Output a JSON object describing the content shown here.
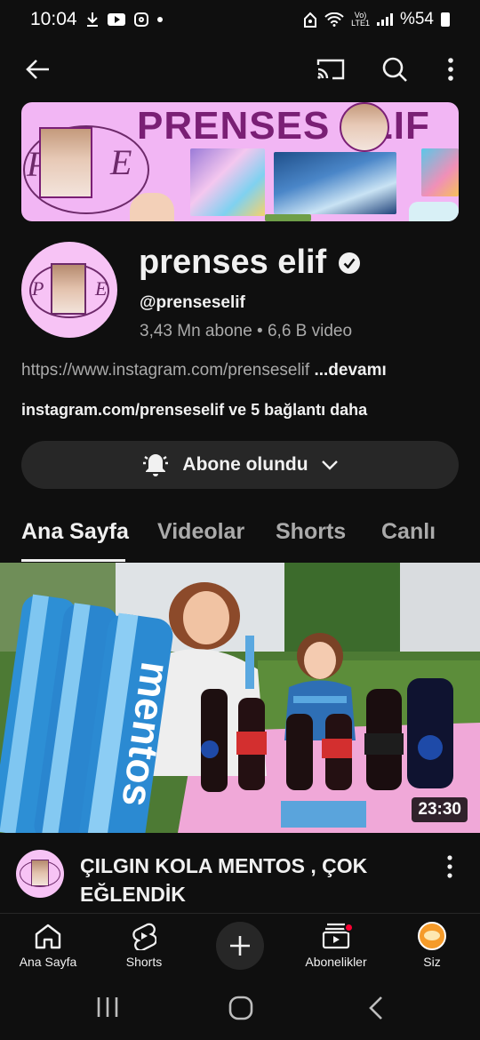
{
  "status_bar": {
    "time": "10:04",
    "battery": "%54",
    "network": "LTE1"
  },
  "banner": {
    "title": "PRENSES ELIF",
    "logo_letters": [
      "P",
      "E"
    ]
  },
  "channel": {
    "name": "prenses elif",
    "handle": "@prenseselif",
    "subscribers": "3,43 Mn abone",
    "separator": "•",
    "videos": "6,6 B video",
    "description": "https://www.instagram.com/prenseselif",
    "more_label": "...devamı",
    "links_text": "instagram.com/prenseselif ve 5 bağlantı daha",
    "subscribe_label": "Abone olundu"
  },
  "tabs": [
    {
      "label": "Ana Sayfa",
      "active": true
    },
    {
      "label": "Videolar",
      "active": false
    },
    {
      "label": "Shorts",
      "active": false
    },
    {
      "label": "Canlı",
      "active": false
    }
  ],
  "video": {
    "duration": "23:30",
    "title": "ÇILGIN KOLA MENTOS , ÇOK EĞLENDİK",
    "thumbnail_text": "mentos"
  },
  "bottom_nav": [
    {
      "label": "Ana Sayfa",
      "icon": "home-icon"
    },
    {
      "label": "Shorts",
      "icon": "shorts-icon"
    },
    {
      "label": "",
      "icon": "create-icon"
    },
    {
      "label": "Abonelikler",
      "icon": "subscriptions-icon"
    },
    {
      "label": "Siz",
      "icon": "you-avatar"
    }
  ],
  "colors": {
    "background": "#0f0f0f",
    "text_primary": "#f1f1f1",
    "text_secondary": "#aaaaaa",
    "button_bg": "#272727",
    "notification_dot": "#ff0033",
    "banner_pink": "#f2b6f4",
    "banner_title": "#7a1f75"
  }
}
